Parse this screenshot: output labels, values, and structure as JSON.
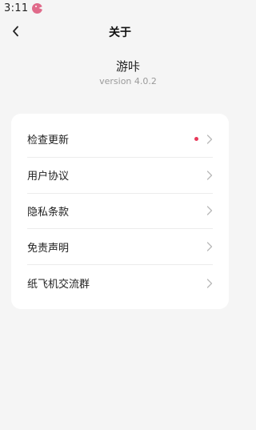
{
  "status_bar": {
    "time": "3:11",
    "app_icon": "pink-pacman-icon"
  },
  "nav": {
    "back_icon": "chevron-left-icon",
    "title": "关于"
  },
  "app_info": {
    "name": "游咔",
    "version": "version 4.0.2"
  },
  "menu": {
    "items": [
      {
        "label": "检查更新",
        "has_dot": true,
        "icon": "chevron-right-icon"
      },
      {
        "label": "用户协议",
        "has_dot": false,
        "icon": "chevron-right-icon"
      },
      {
        "label": "隐私条款",
        "has_dot": false,
        "icon": "chevron-right-icon"
      },
      {
        "label": "免责声明",
        "has_dot": false,
        "icon": "chevron-right-icon"
      },
      {
        "label": "纸飞机交流群",
        "has_dot": false,
        "icon": "chevron-right-icon"
      }
    ]
  },
  "colors": {
    "background": "#f5f5f5",
    "card": "#ffffff",
    "dot": "#e8395a",
    "muted_text": "#9a9a9a"
  }
}
